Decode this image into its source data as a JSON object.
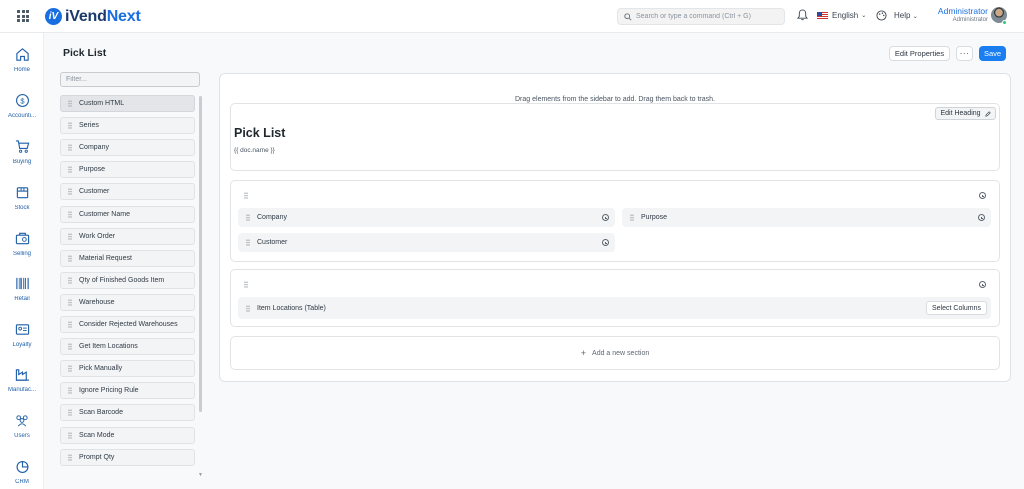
{
  "app": {
    "logo_text_main": "iVend",
    "logo_text_accent": "Next",
    "logo_mark": "iV"
  },
  "topbar": {
    "search_placeholder": "Search or type a command (Ctrl + G)",
    "language": "English",
    "help": "Help",
    "user_name": "Administrator",
    "user_role": "Administrator",
    "colors": {
      "brand": "#1a6fe0",
      "status_online": "#2ecc71"
    }
  },
  "sidebar": {
    "items": [
      {
        "label": "Home",
        "icon": "home-icon"
      },
      {
        "label": "Accounti...",
        "icon": "dollar-icon"
      },
      {
        "label": "Buying",
        "icon": "cart-icon"
      },
      {
        "label": "Stock",
        "icon": "box-icon"
      },
      {
        "label": "Selling",
        "icon": "selling-icon"
      },
      {
        "label": "Retail",
        "icon": "barcode-icon"
      },
      {
        "label": "Loyalty",
        "icon": "loyalty-card-icon"
      },
      {
        "label": "Manufac...",
        "icon": "factory-icon"
      },
      {
        "label": "Users",
        "icon": "users-icon"
      },
      {
        "label": "CRM",
        "icon": "pie-chart-icon"
      }
    ]
  },
  "page": {
    "title": "Pick List",
    "edit_properties": "Edit Properties",
    "more": "···",
    "save": "Save",
    "save_color": "#1a7ef0"
  },
  "fields_panel": {
    "filter_placeholder": "Filter...",
    "fields": [
      "Custom HTML",
      "Series",
      "Company",
      "Purpose",
      "Customer",
      "Customer Name",
      "Work Order",
      "Material Request",
      "Qty of Finished Goods Item",
      "Warehouse",
      "Consider Rejected Warehouses",
      "Get Item Locations",
      "Pick Manually",
      "Ignore Pricing Rule",
      "Scan Barcode",
      "Scan Mode",
      "Prompt Qty"
    ]
  },
  "form_canvas": {
    "hint": "Drag elements from the sidebar to add. Drag them back to trash.",
    "heading": {
      "edit_heading": "Edit Heading",
      "title": "Pick List",
      "subtitle": "{{ doc.name }}"
    },
    "section1": {
      "col1_fields": [
        "Company",
        "Customer"
      ],
      "col2_fields": [
        "Purpose"
      ]
    },
    "section2": {
      "field": "Item Locations (Table)",
      "select_columns": "Select Columns"
    },
    "add_section": "Add a new section"
  }
}
